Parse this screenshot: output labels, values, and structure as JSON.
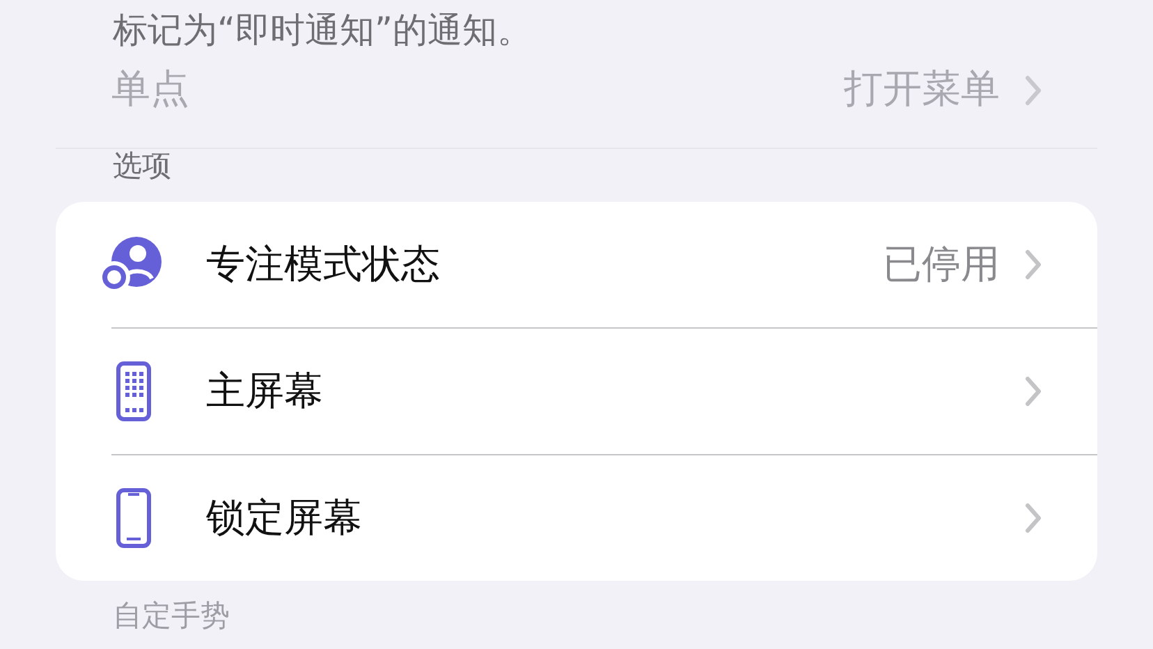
{
  "background": {
    "note": "标记为“即时通知”的通知。",
    "rows": [
      {
        "label": "单点",
        "value": "打开菜单"
      }
    ],
    "section_header": "选项",
    "footer_header": "自定手势"
  },
  "menu": {
    "items": [
      {
        "kind": "focus",
        "label": "专注模式状态",
        "value": "已停用"
      },
      {
        "kind": "home",
        "label": "主屏幕"
      },
      {
        "kind": "lock",
        "label": "锁定屏幕"
      }
    ]
  }
}
